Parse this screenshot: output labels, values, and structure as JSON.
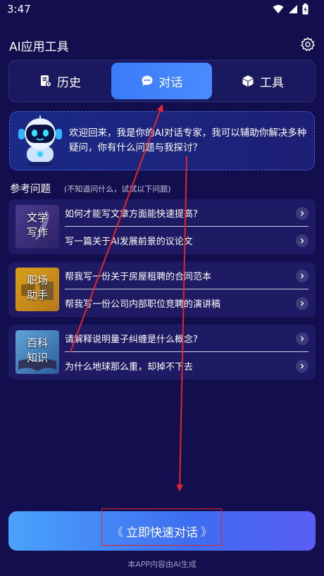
{
  "status_bar": {
    "time": "3:47"
  },
  "header": {
    "title": "AI应用工具"
  },
  "tabs": [
    {
      "label": "历史",
      "icon": "history-doc-icon"
    },
    {
      "label": "对话",
      "icon": "chat-bubble-icon",
      "active": true
    },
    {
      "label": "工具",
      "icon": "cube-icon"
    }
  ],
  "welcome": {
    "text": "欢迎回来，我是你的AI对话专家，我可以辅助你解决多种疑问，你有什么问题与我探讨？"
  },
  "section": {
    "title": "参考问题",
    "hint": "(不知道问什么，试试以下问题)"
  },
  "categories": [
    {
      "label_line1": "文学",
      "label_line2": "写作",
      "questions": [
        "如何才能写文章方面能快速提高?",
        "写一篇关于AI发展前景的议论文"
      ]
    },
    {
      "label_line1": "职场",
      "label_line2": "助手",
      "questions": [
        "帮我写一份关于房屋租聘的合同范本",
        "帮我写一份公司内部职位竞聘的演讲稿"
      ]
    },
    {
      "label_line1": "百科",
      "label_line2": "知识",
      "questions": [
        "请解释说明量子纠缠是什么概念?",
        "为什么地球那么重，却掉不下去"
      ]
    }
  ],
  "cta": {
    "label": "立即快速对话",
    "left_chevrons": "《",
    "right_chevrons": "》"
  },
  "footer": {
    "text": "本APP内容由AI生成"
  },
  "colors": {
    "background": "#130f4e",
    "accent": "#3a7cf8",
    "card": "#1e1a64",
    "annotation": "#e0262c"
  }
}
